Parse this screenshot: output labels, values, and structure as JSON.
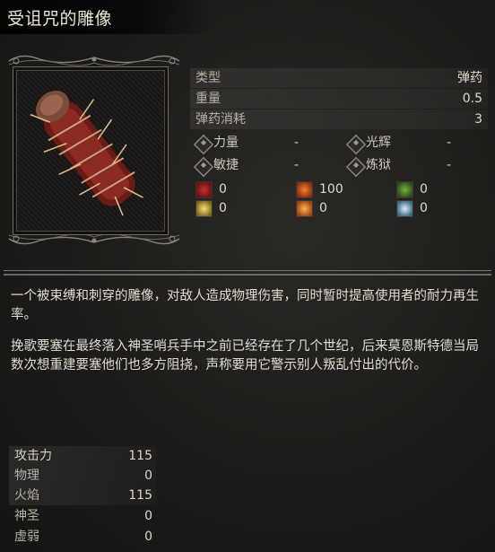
{
  "item": {
    "title": "受诅咒的雕像"
  },
  "info": [
    {
      "label": "类型",
      "value": "弹药"
    },
    {
      "label": "重量",
      "value": "0.5"
    },
    {
      "label": "弹药消耗",
      "value": "3"
    }
  ],
  "requirements": [
    {
      "icon": "strength-icon",
      "label": "力量",
      "value": "-"
    },
    {
      "icon": "dexterity-icon",
      "label": "敏捷",
      "value": "-"
    },
    {
      "icon": "radiance-icon",
      "label": "光辉",
      "value": "-"
    },
    {
      "icon": "inferno-icon",
      "label": "炼狱",
      "value": "-"
    }
  ],
  "effects": [
    {
      "icon": "bleed-icon",
      "value": "0",
      "color": "#9a1e1e"
    },
    {
      "icon": "fire-icon",
      "value": "100",
      "color": "#c8461a"
    },
    {
      "icon": "poison-icon",
      "value": "0",
      "color": "#4a7a2a"
    },
    {
      "icon": "holy-icon",
      "value": "0",
      "color": "#d4b540"
    },
    {
      "icon": "burn-icon",
      "value": "0",
      "color": "#e0702a"
    },
    {
      "icon": "frost-icon",
      "value": "0",
      "color": "#8fb8c8"
    }
  ],
  "description": {
    "p1": "一个被束缚和刺穿的雕像，对敌人造成物理伤害，同时暂时提高使用者的耐力再生率。",
    "p2": "挽歌要塞在最终落入神圣哨兵手中之前已经存在了几个世纪，后来莫恩斯特德当局数次想重建要塞他们也多方阻挠，声称要用它警示别人叛乱付出的代价。"
  },
  "attack": {
    "header": {
      "label": "攻击力",
      "value": "115"
    },
    "rows": [
      {
        "label": "物理",
        "value": "0"
      },
      {
        "label": "火焰",
        "value": "115"
      },
      {
        "label": "神圣",
        "value": "0"
      },
      {
        "label": "虚弱",
        "value": "0"
      }
    ]
  }
}
